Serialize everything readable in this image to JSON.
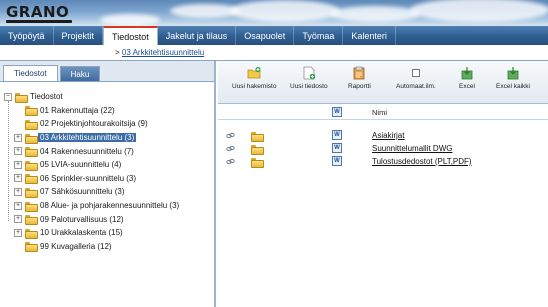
{
  "header": {
    "logo": "GRANO"
  },
  "nav": {
    "tabs": [
      {
        "label": "Työpöytä",
        "active": false
      },
      {
        "label": "Projektit",
        "active": false
      },
      {
        "label": "Tiedostot",
        "active": true
      },
      {
        "label": "Jakelut ja tilaus",
        "active": false
      },
      {
        "label": "Osapuolet",
        "active": false
      },
      {
        "label": "Työmaa",
        "active": false
      },
      {
        "label": "Kalenteri",
        "active": false
      }
    ]
  },
  "breadcrumb": {
    "separator": ">",
    "current": "03 Arkkitehtisuunnittelu"
  },
  "left_panel": {
    "tabs": [
      {
        "label": "Tiedostot",
        "active": true
      },
      {
        "label": "Haku",
        "active": false
      }
    ],
    "root": "Tiedostot",
    "items": [
      {
        "label": "01 Rakennuttaja (22)",
        "expandable": false,
        "selected": false
      },
      {
        "label": "02 Projektinjohtourakoitsija (9)",
        "expandable": false,
        "selected": false
      },
      {
        "label": "03 Arkkitehtisuunnittelu (3)",
        "expandable": true,
        "selected": true
      },
      {
        "label": "04 Rakennesuunnittelu (7)",
        "expandable": true,
        "selected": false
      },
      {
        "label": "05 LVIA-suunnittelu (4)",
        "expandable": true,
        "selected": false
      },
      {
        "label": "06 Sprinkler-suunnittelu (3)",
        "expandable": true,
        "selected": false
      },
      {
        "label": "07 Sähkösuunnittelu (3)",
        "expandable": true,
        "selected": false
      },
      {
        "label": "08 Alue- ja pohjarakennesuunnittelu (3)",
        "expandable": true,
        "selected": false
      },
      {
        "label": "09 Paloturvallisuus (12)",
        "expandable": true,
        "selected": false
      },
      {
        "label": "10 Urakkalaskenta (15)",
        "expandable": true,
        "selected": false
      },
      {
        "label": "99 Kuvagalleria (12)",
        "expandable": false,
        "selected": false
      }
    ]
  },
  "toolbar": {
    "buttons": [
      {
        "label": "Uusi hakemisto",
        "icon": "new-folder-icon"
      },
      {
        "label": "Uusi tiedosto",
        "icon": "new-file-icon"
      },
      {
        "label": "Raportti",
        "icon": "report-icon"
      },
      {
        "label": "Automaat.ilm.",
        "icon": "checkbox-icon"
      },
      {
        "label": "Excel",
        "icon": "excel-download-icon"
      },
      {
        "label": "Excel kaikki",
        "icon": "excel-download-all-icon"
      }
    ]
  },
  "grid": {
    "name_column": "Nimi",
    "rows": [
      {
        "name": "Asiakirjat",
        "type_icon": "W"
      },
      {
        "name": "Suunnittelumallit DWG",
        "type_icon": "W"
      },
      {
        "name": "Tulostusdedostot (PLT,PDF)",
        "type_icon": "W"
      }
    ]
  },
  "colors": {
    "nav_bg": "#2f5f92",
    "active_tab_accent": "#d9351f",
    "selection": "#3d6da8"
  }
}
